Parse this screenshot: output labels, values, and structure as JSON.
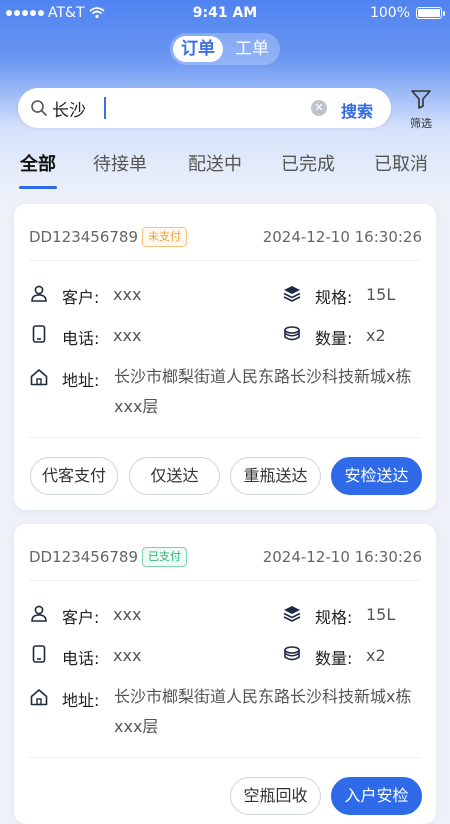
{
  "status_bar": {
    "carrier": "AT&T",
    "time": "9:41 AM",
    "battery": "100%"
  },
  "top_tabs": [
    {
      "label": "订单",
      "active": true
    },
    {
      "label": "工单",
      "active": false
    }
  ],
  "search": {
    "value": "长沙",
    "button_label": "搜索"
  },
  "filter": {
    "label": "筛选"
  },
  "status_tabs": [
    {
      "label": "全部",
      "active": true
    },
    {
      "label": "待接单"
    },
    {
      "label": "配送中"
    },
    {
      "label": "已完成"
    },
    {
      "label": "已取消"
    }
  ],
  "orders": [
    {
      "order_no": "DD123456789",
      "pay_status": "未支付",
      "time": "2024-12-10 16:30:26",
      "customer_label": "客户:",
      "customer": "xxx",
      "spec_label": "规格:",
      "spec": "15L",
      "phone_label": "电话:",
      "phone": "xxx",
      "qty_label": "数量:",
      "qty": "x2",
      "address_label": "地址:",
      "address": "长沙市榔梨街道人民东路长沙科技新城x栋xxx层",
      "actions": [
        "代客支付",
        "仅送达",
        "重瓶送达",
        "安检送达"
      ]
    },
    {
      "order_no": "DD123456789",
      "pay_status": "已支付",
      "time": "2024-12-10 16:30:26",
      "customer_label": "客户:",
      "customer": "xxx",
      "spec_label": "规格:",
      "spec": "15L",
      "phone_label": "电话:",
      "phone": "xxx",
      "qty_label": "数量:",
      "qty": "x2",
      "address_label": "地址:",
      "address": "长沙市榔梨街道人民东路长沙科技新城x栋xxx层",
      "actions": [
        "空瓶回收",
        "入户安检"
      ]
    }
  ],
  "colors": {
    "accent": "#2f6ae8",
    "unpaid": "#f0a13a",
    "paid": "#2cb37a"
  }
}
